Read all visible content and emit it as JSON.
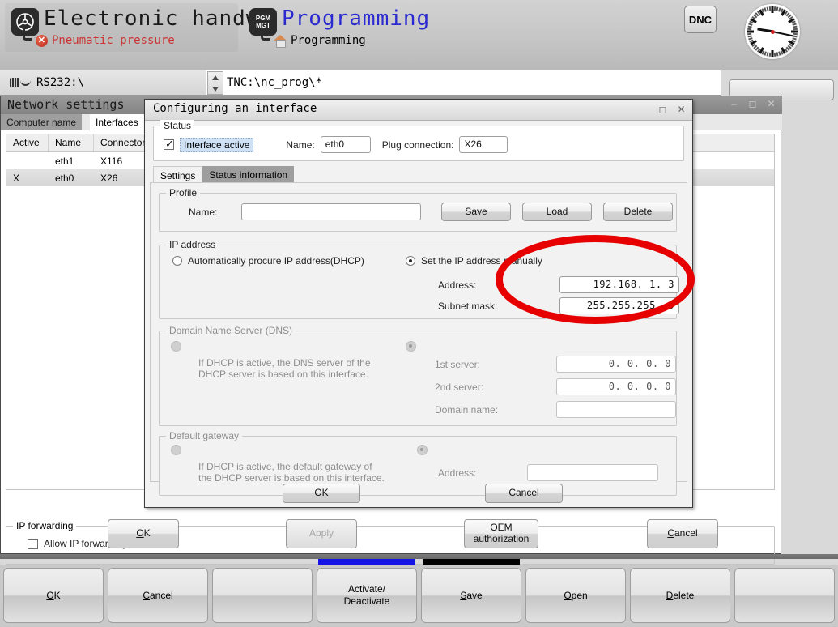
{
  "header": {
    "left_mode": {
      "icon": "handwheel-icon",
      "title": "Electronic handw…",
      "status_text": "Pneumatic pressure",
      "status_icon": "error-x-icon"
    },
    "right_mode": {
      "icon": "pgm-mgt-icon",
      "icon_line1": "PGM",
      "icon_line2": "MGT",
      "title": "Programming",
      "sub_icon": "home-icon",
      "sub_text": "Programming"
    },
    "dnc_badge": "DNC",
    "clock": {
      "icon": "analog-clock-icon",
      "hour": 9,
      "minute": 17
    }
  },
  "pathbar": {
    "left_icon": "rs232-connector-icon",
    "left_path": "RS232:\\",
    "spinner_icon": "spinner-up-down-icon",
    "right_path": "TNC:\\nc_prog\\*"
  },
  "network_window": {
    "title": "Network settings",
    "window_buttons": [
      "minimize-icon",
      "maximize-icon",
      "close-icon"
    ],
    "tabs": [
      {
        "label": "Computer name",
        "active": false
      },
      {
        "label": "Interfaces",
        "active": true
      }
    ],
    "table": {
      "columns": [
        "Active",
        "Name",
        "Connectors"
      ],
      "rows": [
        {
          "active": "",
          "name": "eth1",
          "connectors": "X116",
          "selected": false
        },
        {
          "active": "X",
          "name": "eth0",
          "connectors": "X26",
          "selected": true
        }
      ]
    },
    "ip_forwarding": {
      "group_label": "IP forwarding",
      "checkbox_label": "Allow IP forwarding",
      "checked": false
    },
    "buttons": [
      {
        "label": "OK",
        "accel": "O",
        "disabled": false
      },
      {
        "label": "Apply",
        "accel": "A",
        "disabled": true
      },
      {
        "label": "OEM authorization",
        "line1": "OEM",
        "line2": "authorization",
        "disabled": false
      },
      {
        "label": "Cancel",
        "accel": "C",
        "disabled": false
      }
    ]
  },
  "dialog": {
    "title": "Configuring an interface",
    "window_buttons": [
      "restore-icon",
      "close-icon"
    ],
    "status": {
      "group_label": "Status",
      "active_checkbox_label": "Interface active",
      "active_checked": true,
      "name_label": "Name:",
      "name_value": "eth0",
      "plug_label": "Plug connection:",
      "plug_value": "X26"
    },
    "tabs": [
      {
        "label": "Settings",
        "active": true
      },
      {
        "label": "Status information",
        "active": false
      }
    ],
    "profile": {
      "group_label": "Profile",
      "name_label": "Name:",
      "name_value": "",
      "save_label": "Save",
      "load_label": "Load",
      "delete_label": "Delete"
    },
    "ip_address": {
      "group_label": "IP address",
      "dhcp_label": "Automatically procure IP address(DHCP)",
      "dhcp_selected": false,
      "manual_label": "Set the IP address manually",
      "manual_selected": true,
      "address_label": "Address:",
      "address_value": "192.168.  1.  3",
      "subnet_label": "Subnet mask:",
      "subnet_value": "255.255.255.  0"
    },
    "dns": {
      "group_label": "Domain Name Server (DNS)",
      "disabled": true,
      "dhcp_selected": false,
      "manual_selected": true,
      "dhcp_hint_line1": "If DHCP is active, the DNS server of the",
      "dhcp_hint_line2": "DHCP server is based on this interface.",
      "server1_label": "1st server:",
      "server1_value": "0.  0.  0.  0",
      "server2_label": "2nd server:",
      "server2_value": "0.  0.  0.  0",
      "domain_label": "Domain name:",
      "domain_value": ""
    },
    "gateway": {
      "group_label": "Default gateway",
      "disabled": true,
      "dhcp_selected": false,
      "manual_selected": true,
      "dhcp_hint_line1": "If DHCP is active, the default gateway of",
      "dhcp_hint_line2": "the DHCP server is based on this interface.",
      "address_label": "Address:",
      "address_value": ""
    },
    "ok_label": "OK",
    "ok_accel": "O",
    "cancel_label": "Cancel",
    "cancel_accel": "C"
  },
  "annotation": {
    "type": "red-ellipse-highlight",
    "color": "#e60000",
    "target": "IP address and subnet mask fields"
  },
  "softkeys": {
    "markers": [
      {
        "index": 3,
        "color": "#1414e6"
      },
      {
        "index": 4,
        "color": "#000000"
      }
    ],
    "keys": [
      {
        "label": "OK",
        "accel": "O",
        "line1": "OK",
        "line2": ""
      },
      {
        "label": "Cancel",
        "accel": "C",
        "line1": "Cancel",
        "line2": ""
      },
      {
        "label": "",
        "line1": "",
        "line2": ""
      },
      {
        "label": "Activate/ Deactivate",
        "line1": "Activate/",
        "line2": "Deactivate"
      },
      {
        "label": "Save",
        "accel": "S",
        "line1": "Save",
        "line2": ""
      },
      {
        "label": "Open",
        "accel": "O",
        "line1": "Open",
        "line2": ""
      },
      {
        "label": "Delete",
        "accel": "D",
        "line1": "Delete",
        "line2": ""
      },
      {
        "label": "",
        "line1": "",
        "line2": ""
      }
    ]
  }
}
